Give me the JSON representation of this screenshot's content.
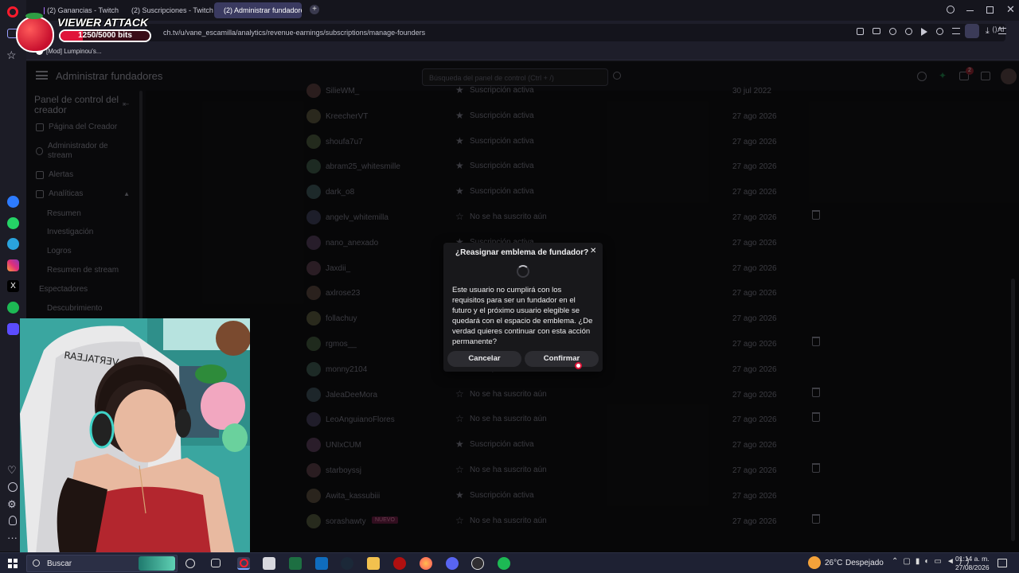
{
  "browser": {
    "tabs": [
      {
        "label": "(2) Ganancias - Twitch",
        "active": false
      },
      {
        "label": "(2) Suscripciones - Twitch",
        "active": false
      },
      {
        "label": "(2) Administrar fundadore",
        "active": true
      }
    ],
    "url": "ch.tv/u/vane_escamilla/analytics/revenue-earnings/subscriptions/manage-founders",
    "bookmark": "[Mod] Lumpinou's...",
    "ai_label": "AI"
  },
  "twitch": {
    "page_title": "Administrar fundadores",
    "search_placeholder": "Búsqueda del panel de control (Ctrl + /)",
    "notif_badge": "2",
    "sidebar": {
      "title": "Panel de control del creador",
      "items": [
        {
          "label": "Página del Creador"
        },
        {
          "label": "Administrador de stream"
        },
        {
          "label": "Alertas"
        },
        {
          "label": "Analíticas"
        },
        {
          "label": "Resumen"
        },
        {
          "label": "Investigación"
        },
        {
          "label": "Logros"
        },
        {
          "label": "Resumen de stream"
        },
        {
          "label": "Espectadores"
        },
        {
          "label": "Descubrimiento"
        }
      ]
    },
    "founders": [
      {
        "user": "SilieWM_",
        "status": "Suscripción activa",
        "date": "30 jul 2022",
        "trash": false
      },
      {
        "user": "KreecherVT",
        "status": "Suscripción activa",
        "date": "27 ago 2026",
        "trash": false
      },
      {
        "user": "shoufa7u7",
        "status": "Suscripción activa",
        "date": "27 ago 2026",
        "trash": false
      },
      {
        "user": "abram25_whitesmille",
        "status": "Suscripción activa",
        "date": "27 ago 2026",
        "trash": false
      },
      {
        "user": "dark_o8",
        "status": "Suscripción activa",
        "date": "27 ago 2026",
        "trash": false
      },
      {
        "user": "angelv_whitemilla",
        "status": "No se ha suscrito aún",
        "date": "27 ago 2026",
        "trash": true
      },
      {
        "user": "nano_anexado",
        "status": "Suscripción activa",
        "date": "27 ago 2026",
        "trash": false
      },
      {
        "user": "Jaxdii_",
        "status": "Suscripción activa",
        "date": "27 ago 2026",
        "trash": false
      },
      {
        "user": "axlrose23",
        "status": "Suscripción activa",
        "date": "27 ago 2026",
        "trash": false
      },
      {
        "user": "follachuy",
        "status": "Suscripción activa",
        "date": "27 ago 2026",
        "trash": false
      },
      {
        "user": "rgmos__",
        "status": "No se ha suscrito aún",
        "date": "27 ago 2026",
        "trash": true
      },
      {
        "user": "monny2104",
        "status": "Suscripción activa",
        "date": "27 ago 2026",
        "trash": false
      },
      {
        "user": "JaleaDeeMora",
        "status": "No se ha suscrito aún",
        "date": "27 ago 2026",
        "trash": true
      },
      {
        "user": "LeoAnguianoFlores",
        "status": "No se ha suscrito aún",
        "date": "27 ago 2026",
        "trash": true
      },
      {
        "user": "UNIxCUM",
        "status": "Suscripción activa",
        "date": "27 ago 2026",
        "trash": false
      },
      {
        "user": "starboyssj",
        "status": "No se ha suscrito aún",
        "date": "27 ago 2026",
        "trash": true
      },
      {
        "user": "Awita_kassubiii",
        "status": "Suscripción activa",
        "date": "27 ago 2026",
        "trash": false
      },
      {
        "user": "sorashawty",
        "badge": "NUEVO",
        "status": "No se ha suscrito aún",
        "date": "27 ago 2026",
        "trash": true
      }
    ]
  },
  "modal": {
    "title": "¿Reasignar emblema de fundador?",
    "body": "Este usuario no cumplirá con los requisitos para ser un fundador en el futuro y el próximo usuario elegible se quedará con el espacio de emblema. ¿De verdad quieres continuar con esta acción permanente?",
    "cancel_label": "Cancelar",
    "confirm_label": "Confirmar"
  },
  "overlay": {
    "title": "VIEWER ATTACK",
    "bits": "1250/5000 bits",
    "bits_progress": 0.25
  },
  "taskbar": {
    "search_label": "Buscar",
    "weather_temp": "26°C",
    "weather_desc": "Despejado",
    "time": "01:14 a. m.",
    "date": "27/08/2026"
  },
  "colors": {
    "twitch_purple": "#9147ff",
    "modal_bg": "#18181b",
    "badge_pink": "#e91e63"
  }
}
